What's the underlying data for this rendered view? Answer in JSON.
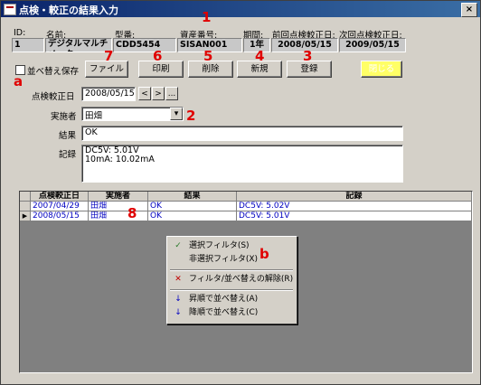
{
  "window": {
    "title": "点検・較正の結果入力",
    "close_glyph": "×"
  },
  "header": {
    "labels": [
      "ID:",
      "名前:",
      "型番:",
      "資産番号:",
      "期間:",
      "前回点検較正日:",
      "次回点検較正日:"
    ],
    "values": [
      "1",
      "デジタルマルチメーター",
      "CDD5454",
      "SISAN001",
      "1年",
      "2008/05/15",
      "2009/05/15"
    ]
  },
  "toolbar": {
    "sort_save_label": "並べ替え保存",
    "file": "ファイル",
    "print": "印刷",
    "delete": "削除",
    "new": "新規",
    "register": "登録",
    "close": "閉じる"
  },
  "form": {
    "date_label": "点検較正日",
    "date_value": "2008/05/15",
    "nav_prev": "<",
    "nav_next": ">",
    "nav_more": "...",
    "person_label": "実施者",
    "person_value": "田畑",
    "dropdown_glyph": "▾",
    "result_label": "結果",
    "result_value": "OK",
    "record_label": "記録",
    "record_line1": "DC5V: 5.01V",
    "record_line2": "10mA: 10.02mA"
  },
  "grid": {
    "columns": [
      "点検較正日",
      "実施者",
      "結果",
      "記録"
    ],
    "rows": [
      {
        "selector": "",
        "date": "2007/04/29",
        "person": "田畑",
        "result": "OK",
        "record": "DC5V: 5.02V"
      },
      {
        "selector": "▶",
        "date": "2008/05/15",
        "person": "田畑",
        "result": "OK",
        "record": "DC5V: 5.01V"
      }
    ]
  },
  "context_menu": [
    {
      "icon": "✓",
      "label": "選択フィルタ(S)"
    },
    {
      "icon": "",
      "label": "非選択フィルタ(X)"
    },
    {
      "icon": "✕",
      "label": "フィルタ/並べ替えの解除(R)"
    },
    {
      "icon": "↓",
      "label": "昇順で並べ替え(A)"
    },
    {
      "icon": "↓",
      "label": "降順で並べ替え(C)"
    }
  ],
  "callouts": {
    "n1": "1",
    "n2": "2",
    "n3": "3",
    "n4": "4",
    "n5": "5",
    "n6": "6",
    "n7": "7",
    "n8": "8",
    "a": "a",
    "b": "b"
  },
  "colors": {
    "callout": "#e00000",
    "titlebar": "#0a246a",
    "disabled_button": "#ffff66",
    "grid_text": "#0000c0"
  }
}
